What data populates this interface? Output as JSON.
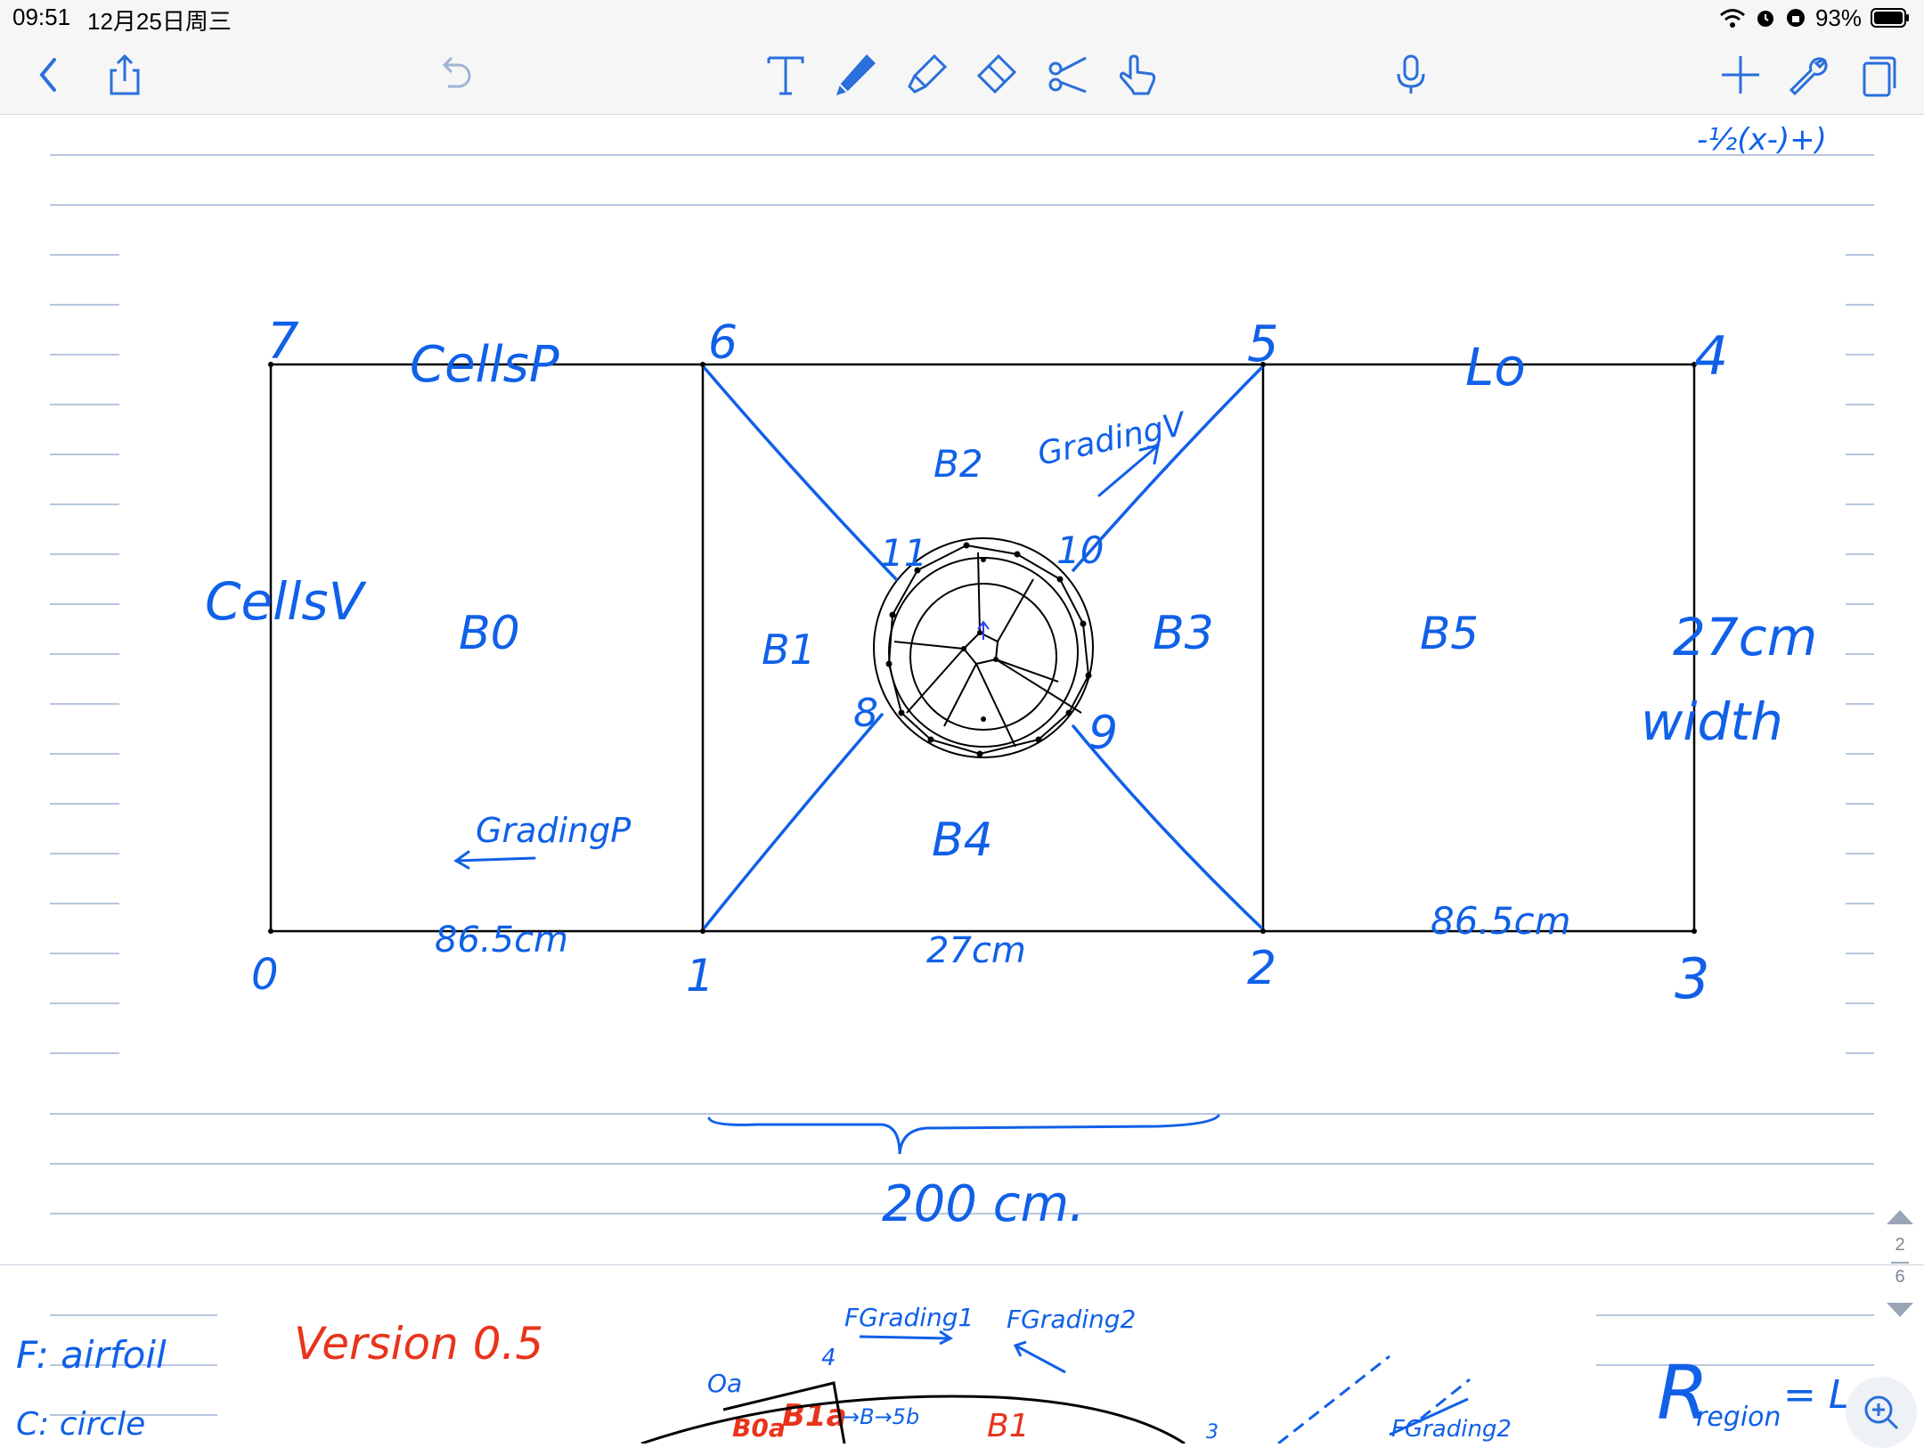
{
  "status_bar": {
    "time": "09:51",
    "date": "12月25日周三",
    "battery": "93%"
  },
  "toolbar": {
    "left": [
      "back-icon",
      "share-icon",
      "undo-icon"
    ],
    "center": [
      "text-tool-icon",
      "pen-icon",
      "highlighter-icon",
      "eraser-icon",
      "scissors-icon",
      "hand-icon"
    ],
    "right": [
      "microphone-icon",
      "add-icon",
      "wrench-icon",
      "pages-icon"
    ]
  },
  "note": {
    "top_scribble": "-½(x-)+)",
    "vertices": {
      "v0": "0",
      "v1": "1",
      "v2": "2",
      "v3": "3",
      "v4": "4",
      "v5": "5",
      "v6": "6",
      "v7": "7",
      "v8": "8",
      "v9": "9",
      "v10": "10",
      "v11": "11"
    },
    "blocks": {
      "b0": "B0",
      "b1": "B1",
      "b2": "B2",
      "b3": "B3",
      "b4": "B4",
      "b5": "B5"
    },
    "labels": {
      "cells_p": "CellsP",
      "cells_v": "CellsV",
      "lo": "Lo",
      "grading_v": "GradingV",
      "grading_p": "GradingP",
      "width_value": "27cm",
      "width_word": "width",
      "bottom_left": "86.5cm",
      "bottom_mid": "27cm",
      "bottom_right": "86.5cm",
      "total": "200 cm."
    }
  },
  "next_page": {
    "f_airfoil": "F: airfoil",
    "circle": "C: circle",
    "version": "Version 0.5",
    "f_grading1": "FGrading1",
    "f_grading2": "FGrading2",
    "oa": "Oa",
    "n4": "4",
    "b1a": "B1a",
    "b0a": "B0a",
    "b1": "B1",
    "to": "→B→5b",
    "n3": "3",
    "f_grading2b": "FGrading2",
    "r_region": "R",
    "region": "region",
    "eq": "= L"
  },
  "pager": {
    "current": "2",
    "total": "6"
  },
  "colors": {
    "ink_blue": "#1060e8",
    "ink_red": "#e8341c",
    "rule_line": "#b8c6de",
    "accent": "#2a6fdb"
  }
}
